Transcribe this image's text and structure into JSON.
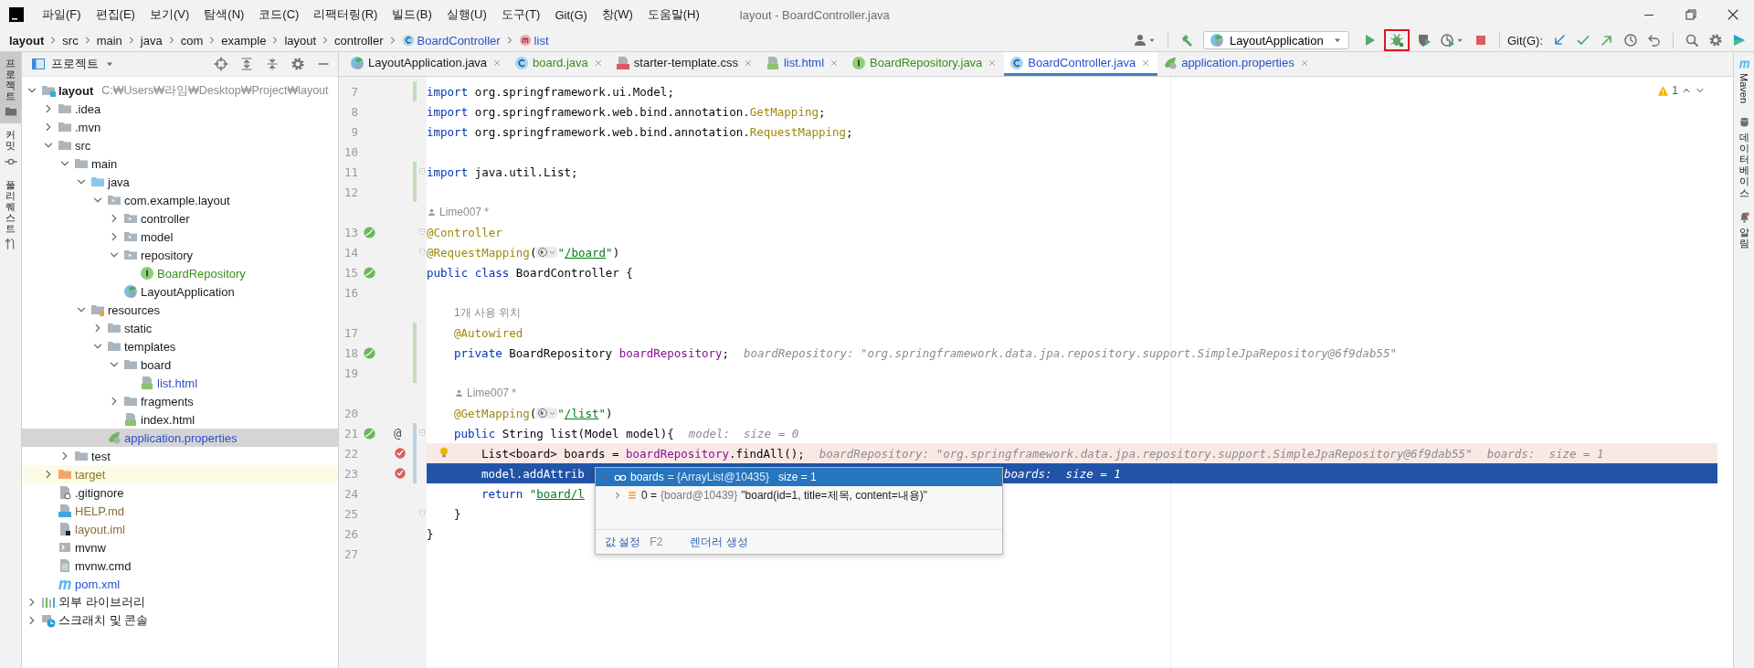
{
  "menu_bar": {
    "items": [
      "파일(F)",
      "편집(E)",
      "보기(V)",
      "탐색(N)",
      "코드(C)",
      "리팩터링(R)",
      "빌드(B)",
      "실행(U)",
      "도구(T)",
      "Git(G)",
      "창(W)",
      "도움말(H)"
    ],
    "title": "layout - BoardController.java"
  },
  "breadcrumb": [
    {
      "text": "layout",
      "kind": "project"
    },
    {
      "text": "src",
      "kind": "folder"
    },
    {
      "text": "main",
      "kind": "folder"
    },
    {
      "text": "java",
      "kind": "folder"
    },
    {
      "text": "com",
      "kind": "folder"
    },
    {
      "text": "example",
      "kind": "folder"
    },
    {
      "text": "layout",
      "kind": "folder"
    },
    {
      "text": "controller",
      "kind": "folder"
    },
    {
      "text": "BoardController",
      "kind": "class"
    },
    {
      "text": "list",
      "kind": "method"
    }
  ],
  "toolbar": {
    "run_config": "LayoutApplication",
    "git_label": "Git(G):"
  },
  "left_strip": [
    {
      "label": "프로젝트",
      "selected": true
    },
    {
      "label": "커밋",
      "selected": false
    },
    {
      "label": "풀 리퀘스트",
      "selected": false
    }
  ],
  "project_panel": {
    "title": "프로젝트"
  },
  "project_tree": [
    {
      "name": "layout",
      "kind": "module",
      "expanded": true,
      "selected": false,
      "path": "C:₩Users₩라임₩Desktop₩Project₩layout",
      "children": [
        {
          "name": ".idea",
          "kind": "folder",
          "expanded": false,
          "selected": false
        },
        {
          "name": ".mvn",
          "kind": "folder",
          "expanded": false,
          "selected": false
        },
        {
          "name": "src",
          "kind": "folder",
          "expanded": true,
          "selected": false,
          "children": [
            {
              "name": "main",
              "kind": "folder",
              "expanded": true,
              "selected": false,
              "children": [
                {
                  "name": "java",
                  "kind": "source-folder",
                  "expanded": true,
                  "selected": false,
                  "children": [
                    {
                      "name": "com.example.layout",
                      "kind": "package",
                      "expanded": true,
                      "selected": false,
                      "children": [
                        {
                          "name": "controller",
                          "kind": "package",
                          "expanded": false,
                          "selected": false
                        },
                        {
                          "name": "model",
                          "kind": "package",
                          "expanded": false,
                          "selected": false
                        },
                        {
                          "name": "repository",
                          "kind": "package",
                          "expanded": true,
                          "selected": false,
                          "children": [
                            {
                              "name": "BoardRepository",
                              "kind": "interface",
                              "color": "#3a8c1d",
                              "selected": false
                            }
                          ]
                        },
                        {
                          "name": "LayoutApplication",
                          "kind": "spring-class",
                          "selected": false
                        }
                      ]
                    }
                  ]
                },
                {
                  "name": "resources",
                  "kind": "resource-folder",
                  "expanded": true,
                  "selected": false,
                  "children": [
                    {
                      "name": "static",
                      "kind": "folder",
                      "expanded": false,
                      "selected": false
                    },
                    {
                      "name": "templates",
                      "kind": "folder",
                      "expanded": true,
                      "selected": false,
                      "children": [
                        {
                          "name": "board",
                          "kind": "folder",
                          "expanded": true,
                          "selected": false,
                          "children": [
                            {
                              "name": "list.html",
                              "kind": "html",
                              "color": "#2a4fcc",
                              "selected": false
                            }
                          ]
                        },
                        {
                          "name": "fragments",
                          "kind": "folder",
                          "expanded": false,
                          "selected": false
                        },
                        {
                          "name": "index.html",
                          "kind": "html",
                          "selected": false
                        }
                      ]
                    },
                    {
                      "name": "application.properties",
                      "kind": "properties",
                      "color": "#2a4fcc",
                      "selected": true
                    }
                  ]
                }
              ]
            },
            {
              "name": "test",
              "kind": "folder",
              "expanded": false,
              "selected": false
            }
          ]
        },
        {
          "name": "target",
          "kind": "excluded-folder",
          "color": "#8a7a30",
          "expanded": false,
          "selected": false
        },
        {
          "name": ".gitignore",
          "kind": "ignore-file",
          "selected": false
        },
        {
          "name": "HELP.md",
          "kind": "md",
          "color": "#8a6c3a",
          "selected": false
        },
        {
          "name": "layout.iml",
          "kind": "iml",
          "color": "#8a6c3a",
          "selected": false
        },
        {
          "name": "mvnw",
          "kind": "script",
          "selected": false
        },
        {
          "name": "mvnw.cmd",
          "kind": "text-file",
          "selected": false
        },
        {
          "name": "pom.xml",
          "kind": "maven",
          "color": "#2a4fcc",
          "selected": false
        }
      ]
    },
    {
      "name": "외부 라이브러리",
      "kind": "libraries",
      "expanded": false,
      "selected": false
    },
    {
      "name": "스크래치 및 콘솔",
      "kind": "scratches",
      "expanded": false,
      "selected": false
    }
  ],
  "editor_tabs": [
    {
      "label": "LayoutApplication.java",
      "kind": "spring-class",
      "selected": false
    },
    {
      "label": "board.java",
      "kind": "class",
      "color": "#3a8c1d",
      "selected": false
    },
    {
      "label": "starter-template.css",
      "kind": "css",
      "selected": false
    },
    {
      "label": "list.html",
      "kind": "html",
      "color": "#2a4fcc",
      "selected": false
    },
    {
      "label": "BoardRepository.java",
      "kind": "interface",
      "color": "#3a8c1d",
      "selected": false
    },
    {
      "label": "BoardController.java",
      "kind": "class",
      "color": "#2a4fcc",
      "selected": true
    },
    {
      "label": "application.properties",
      "kind": "properties",
      "color": "#2a4fcc",
      "selected": false
    }
  ],
  "editor": {
    "warnings": "1",
    "lines": [
      {
        "kind": "code",
        "number": "7",
        "color": "#c4dcbc",
        "tokens": [
          {
            "kind": "keyword",
            "text": "import"
          },
          {
            "kind": "plain",
            "text": " org.springframework.ui.Model;"
          }
        ]
      },
      {
        "kind": "code",
        "number": "8",
        "tokens": [
          {
            "kind": "keyword",
            "text": "import"
          },
          {
            "kind": "plain",
            "text": " org.springframework.web.bind.annotation."
          },
          {
            "kind": "annotation",
            "text": "GetMapping"
          },
          {
            "kind": "plain",
            "text": ";"
          }
        ]
      },
      {
        "kind": "code",
        "number": "9",
        "tokens": [
          {
            "kind": "keyword",
            "text": "import"
          },
          {
            "kind": "plain",
            "text": " org.springframework.web.bind.annotation."
          },
          {
            "kind": "annotation",
            "text": "RequestMapping"
          },
          {
            "kind": "plain",
            "text": ";"
          }
        ]
      },
      {
        "kind": "code",
        "number": "10"
      },
      {
        "kind": "code",
        "number": "11",
        "color": "#c4dcbc",
        "fold": true,
        "tokens": [
          {
            "kind": "keyword",
            "text": "import"
          },
          {
            "kind": "plain",
            "text": " java.util.List;"
          }
        ]
      },
      {
        "kind": "code",
        "number": "12",
        "color": "#c4dcbc"
      },
      {
        "kind": "author",
        "text": "Lime007 *"
      },
      {
        "kind": "code",
        "number": "13",
        "bean": true,
        "fold": true,
        "tokens": [
          {
            "kind": "annotation",
            "text": "@Controller"
          }
        ]
      },
      {
        "kind": "code",
        "number": "14",
        "fold": true,
        "tokens": [
          {
            "kind": "annotation",
            "text": "@RequestMapping"
          },
          {
            "kind": "plain",
            "text": "("
          },
          {
            "kind": "url-inlay"
          },
          {
            "kind": "string",
            "text": "\""
          },
          {
            "kind": "link",
            "text": "/board"
          },
          {
            "kind": "string",
            "text": "\""
          },
          {
            "kind": "plain",
            "text": ")"
          }
        ]
      },
      {
        "kind": "code",
        "number": "15",
        "bean": true,
        "tokens": [
          {
            "kind": "keyword",
            "text": "public class"
          },
          {
            "kind": "plain",
            "text": " BoardController {"
          }
        ]
      },
      {
        "kind": "code",
        "number": "16"
      },
      {
        "kind": "member-usages",
        "text": "1개 사용 위치"
      },
      {
        "kind": "member-code",
        "number": "17",
        "color": "#c4dcbc",
        "tokens": [
          {
            "kind": "annotation",
            "text": "@Autowired"
          }
        ]
      },
      {
        "kind": "member-code",
        "number": "18",
        "color": "#c4dcbc",
        "bean": true,
        "tokens": [
          {
            "kind": "keyword",
            "text": "private"
          },
          {
            "kind": "plain",
            "text": " BoardRepository "
          },
          {
            "kind": "field",
            "text": "boardRepository"
          },
          {
            "kind": "plain",
            "text": ";"
          },
          {
            "kind": "hint",
            "text": "boardRepository: \"org.springframework.data.jpa.repository.support.SimpleJpaRepository@6f9dab55\""
          }
        ]
      },
      {
        "kind": "code",
        "number": "19",
        "color": "#c4dcbc"
      },
      {
        "kind": "member-author",
        "text": "Lime007 *"
      },
      {
        "kind": "member-code",
        "number": "20",
        "tokens": [
          {
            "kind": "annotation",
            "text": "@GetMapping"
          },
          {
            "kind": "plain",
            "text": "("
          },
          {
            "kind": "url-inlay"
          },
          {
            "kind": "string",
            "text": "\""
          },
          {
            "kind": "link",
            "text": "/list"
          },
          {
            "kind": "string",
            "text": "\""
          },
          {
            "kind": "plain",
            "text": ")"
          }
        ]
      },
      {
        "kind": "member-code",
        "number": "21",
        "color": "#bccfe6",
        "bean": true,
        "gutter_mark": "@",
        "fold": true,
        "tokens": [
          {
            "kind": "keyword",
            "text": "public"
          },
          {
            "kind": "plain",
            "text": " String list(Model model){"
          },
          {
            "kind": "hint",
            "text": "model:  size = 0"
          }
        ]
      },
      {
        "kind": "body-code",
        "number": "22",
        "color": "#bccfe6",
        "breakpoint": true,
        "bulb": true,
        "current": false,
        "tokens": [
          {
            "kind": "plain",
            "text": "List<board> boards = "
          },
          {
            "kind": "field",
            "text": "boardRepository"
          },
          {
            "kind": "plain",
            "text": ".findAll();"
          },
          {
            "kind": "hint",
            "text": "boardRepository: \"org.springframework.data.jpa.repository.support.SimpleJpaRepository@6f9dab55\""
          },
          {
            "kind": "hint",
            "text": "boards:  size = 1"
          }
        ]
      },
      {
        "kind": "body-code",
        "number": "23",
        "color": "#bccfe6",
        "breakpoint": true,
        "current": true,
        "tokens": [
          {
            "kind": "plain",
            "text": "model.addAttrib"
          },
          {
            "kind": "hint",
            "text": "boards:  size = 1"
          }
        ]
      },
      {
        "kind": "body-code",
        "number": "24",
        "tokens": [
          {
            "kind": "keyword",
            "text": "return"
          },
          {
            "kind": "string",
            "text": " \""
          },
          {
            "kind": "link",
            "text": "board/l"
          }
        ]
      },
      {
        "kind": "member-code",
        "number": "25",
        "fold": true,
        "tokens": [
          {
            "kind": "plain",
            "text": "}"
          }
        ]
      },
      {
        "kind": "code",
        "number": "26",
        "tokens": [
          {
            "kind": "plain",
            "text": "}"
          }
        ]
      },
      {
        "kind": "code",
        "number": "27"
      }
    ],
    "debug_popup": {
      "expanded": true,
      "name": "boards",
      "value": "= {ArrayList@10435}",
      "size": "size = 1",
      "children": [
        {
          "expanded": false,
          "index": "0 =",
          "ref": "{board@10439}",
          "value": "\"board(id=1, title=제목, content=내용)\""
        }
      ],
      "actions": [
        {
          "label": "값 설정",
          "shortcut": "F2"
        },
        {
          "label": "렌더러 생성"
        }
      ]
    }
  },
  "right_strip": [
    {
      "label": "Maven",
      "kind": "maven"
    },
    {
      "label": "데이터베이스",
      "kind": "database"
    },
    {
      "label": "알림",
      "kind": "bell"
    }
  ]
}
